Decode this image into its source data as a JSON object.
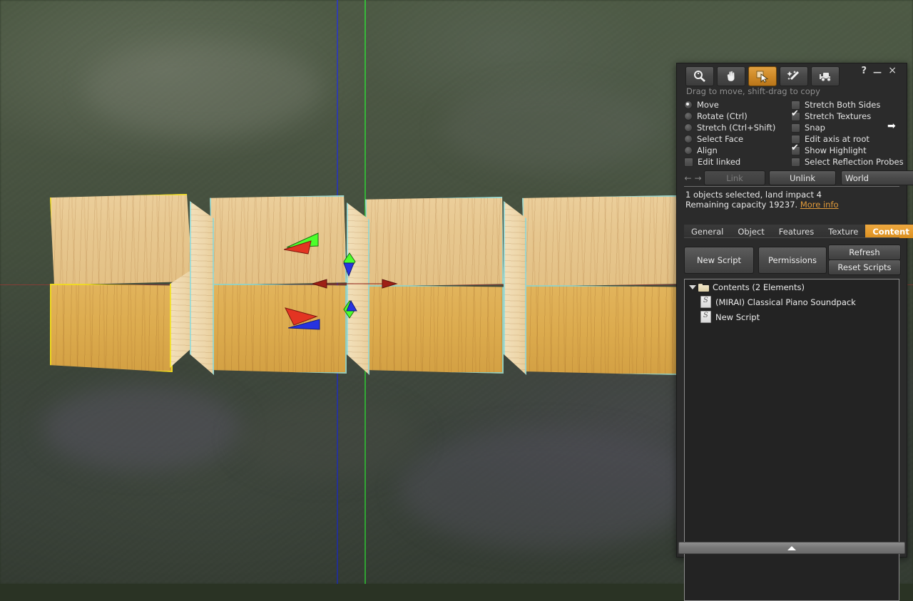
{
  "viewport": {
    "name": "second-life-3d-viewport",
    "axis_colors": {
      "x": "#b33333",
      "y": "#35c23a",
      "z": "#2b36c8"
    },
    "selection_outline_color": "#f2e01a",
    "highlight_outline_color": "#7fd9e0",
    "objects": [
      {
        "label": "wood-cube-1",
        "selected": true
      },
      {
        "label": "wood-cube-2",
        "selected": false
      },
      {
        "label": "wood-cube-3",
        "selected": false
      },
      {
        "label": "wood-cube-4",
        "selected": false
      }
    ]
  },
  "floater": {
    "window_controls": {
      "help": "?",
      "minimize": "—",
      "close": "×"
    },
    "tools": [
      {
        "name": "focus-tool",
        "icon": "magnifier-icon",
        "active": false
      },
      {
        "name": "move-tool",
        "icon": "hand-icon",
        "active": false
      },
      {
        "name": "edit-tool",
        "icon": "cursor-arrow-icon",
        "active": true
      },
      {
        "name": "create-tool",
        "icon": "magic-wand-icon",
        "active": false
      },
      {
        "name": "land-tool",
        "icon": "bulldozer-icon",
        "active": false
      }
    ],
    "hint": "Drag to move, shift-drag to copy",
    "radios": [
      {
        "label": "Move",
        "checked": true
      },
      {
        "label": "Rotate (Ctrl)",
        "checked": false
      },
      {
        "label": "Stretch (Ctrl+Shift)",
        "checked": false
      },
      {
        "label": "Select Face",
        "checked": false
      },
      {
        "label": "Align",
        "checked": false
      }
    ],
    "edit_linked": {
      "label": "Edit linked",
      "checked": false
    },
    "checkboxes": [
      {
        "label": "Stretch Both Sides",
        "checked": false
      },
      {
        "label": "Stretch Textures",
        "checked": true
      },
      {
        "label": "Snap",
        "checked": false
      },
      {
        "label": "Edit axis at root",
        "checked": false
      },
      {
        "label": "Show Highlight",
        "checked": true
      },
      {
        "label": "Select Reflection Probes",
        "checked": false
      }
    ],
    "link_row": {
      "prev_arrow": "←",
      "next_arrow": "→",
      "link_label": "Link",
      "unlink_label": "Unlink",
      "grid_value": "World",
      "grid_chevron": "▾"
    },
    "status": {
      "line1": "1 objects selected, land impact 4",
      "line2_prefix": "Remaining capacity 19237. ",
      "more_info": "More info",
      "more_info_color": "#e09a3a"
    },
    "tabs": [
      {
        "label": "General",
        "active": false
      },
      {
        "label": "Object",
        "active": false
      },
      {
        "label": "Features",
        "active": false
      },
      {
        "label": "Texture",
        "active": false
      },
      {
        "label": "Content",
        "active": true
      }
    ],
    "active_tab_color": "#e59b2d",
    "actions": {
      "new_script": "New Script",
      "permissions": "Permissions",
      "refresh": "Refresh",
      "reset_scripts": "Reset Scripts"
    },
    "contents": {
      "root_label": "Contents (2 Elements)",
      "items": [
        {
          "label": "(MIRAI) Classical Piano Soundpack",
          "icon": "script-icon"
        },
        {
          "label": "New Script",
          "icon": "script-icon"
        }
      ]
    }
  }
}
